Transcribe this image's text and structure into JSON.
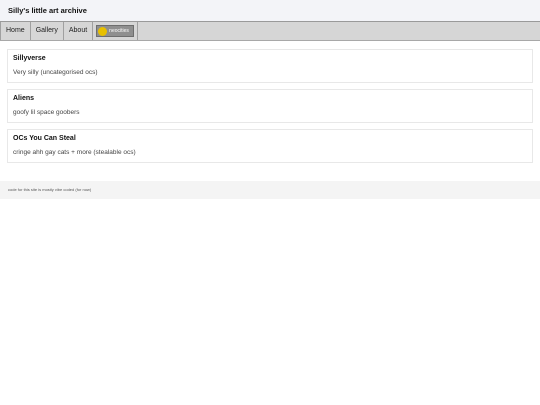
{
  "header": {
    "title": "Silly's little art archive"
  },
  "nav": {
    "items": [
      "Home",
      "Gallery",
      "About"
    ],
    "badge_text": "neocities"
  },
  "cards": [
    {
      "title": "Sillyverse",
      "desc": "Very silly (uncategorised ocs)"
    },
    {
      "title": "Aliens",
      "desc": "goofy lil space goobers"
    },
    {
      "title": "OCs You Can Steal",
      "desc": "cringe ahh gay cats + more (stealable ocs)"
    }
  ],
  "footer": {
    "text": "code for this site is mostly vibe coded (for now)"
  }
}
